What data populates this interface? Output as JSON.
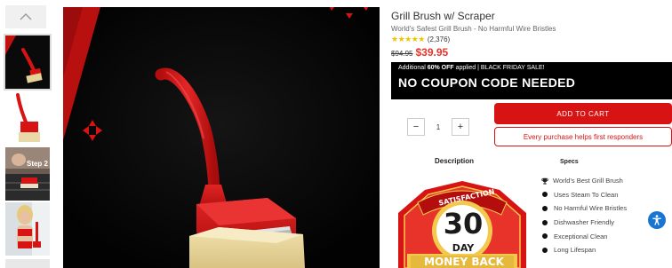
{
  "gallery": {
    "scroll_up_icon": "chevron-up-icon",
    "thumbnails": [
      {
        "alt": "Grill brush top view"
      },
      {
        "alt": "Grill brush side view"
      },
      {
        "alt": "Using the brush on a grill",
        "caption": "Step 2"
      },
      {
        "alt": "Woman holding grill brush"
      }
    ]
  },
  "product": {
    "title": "Grill Brush w/ Scraper",
    "subtitle": "World's Safest Grill Brush - No Harmful Wire Bristles",
    "stars": "★★★★★",
    "review_count": "(2,376)",
    "old_price": "$94.95",
    "new_price": "$39.95",
    "accent_color": "#d81313"
  },
  "promo": {
    "prefix": "Additional ",
    "discount": "60% OFF",
    "suffix": " applied | BLACK FRIDAY SALE!",
    "headline": "NO COUPON CODE NEEDED"
  },
  "purchase": {
    "decrement": "−",
    "quantity": "1",
    "increment": "+",
    "add_to_cart": "ADD TO CART",
    "responders": "Every purchase helps first responders"
  },
  "tabs": {
    "description": "Description",
    "specs": "Specs"
  },
  "badge": {
    "top": "SATISFACTION",
    "number": "30",
    "unit": "DAY",
    "bottom": "MONEY BACK"
  },
  "features": [
    {
      "label": "World's Best Grill Brush",
      "icon": "trophy-icon"
    },
    {
      "label": "Uses Steam To Clean",
      "icon": "bullet-icon"
    },
    {
      "label": "No Harmful Wire Bristles",
      "icon": "bullet-icon"
    },
    {
      "label": "Dishwasher Friendly",
      "icon": "bullet-icon"
    },
    {
      "label": "Exceptional Clean",
      "icon": "bullet-icon"
    },
    {
      "label": "Long Lifespan",
      "icon": "bullet-icon"
    }
  ],
  "accessibility": {
    "icon": "accessibility-icon"
  }
}
